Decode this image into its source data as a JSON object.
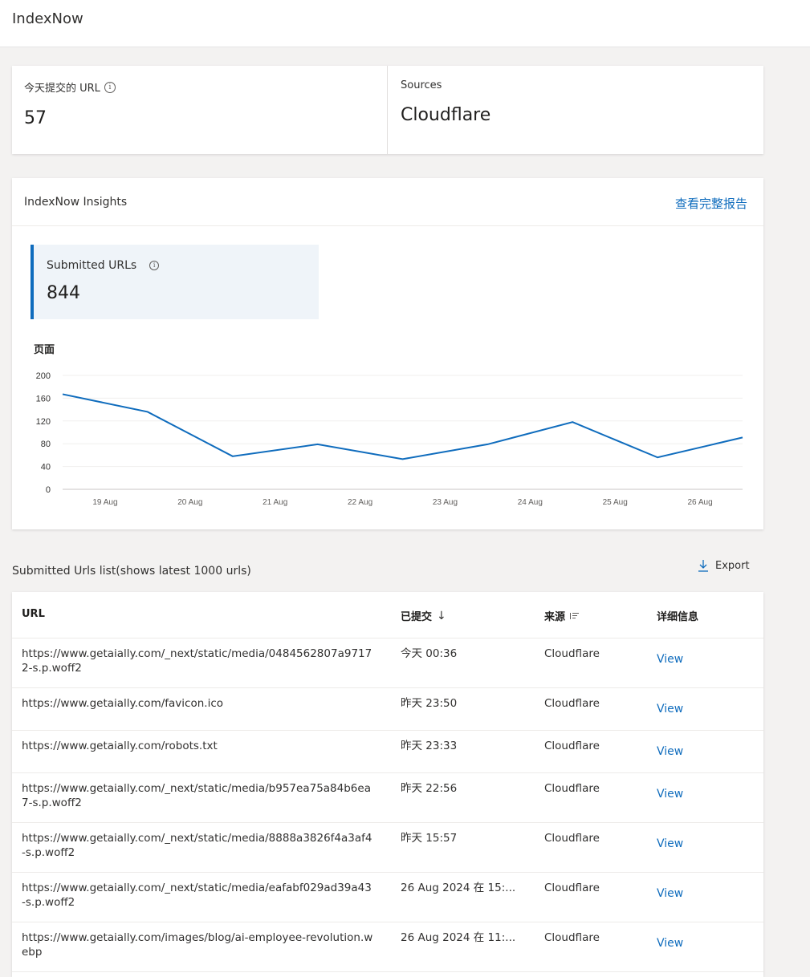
{
  "app": {
    "title": "IndexNow"
  },
  "stats": {
    "today": {
      "label": "今天提交的 URL",
      "value": "57"
    },
    "sources": {
      "label": "Sources",
      "value": "Cloudflare"
    }
  },
  "insights": {
    "title": "IndexNow Insights",
    "full_report_link": "查看完整报告",
    "metric": {
      "label": "Submitted URLs",
      "value": "844"
    }
  },
  "chart_data": {
    "type": "line",
    "ylabel": "页面",
    "ylim": [
      0,
      200
    ],
    "yticks": [
      "0",
      "40",
      "80",
      "120",
      "160",
      "200"
    ],
    "xticks": [
      "19 Aug",
      "20 Aug",
      "21 Aug",
      "22 Aug",
      "23 Aug",
      "24 Aug",
      "25 Aug",
      "26 Aug"
    ],
    "x": [
      0,
      1,
      2,
      3,
      4,
      5,
      6,
      7,
      8
    ],
    "values": [
      167,
      136,
      58,
      79,
      53,
      79,
      118,
      56,
      91
    ],
    "color": "#0f6cbd",
    "grid": true
  },
  "list": {
    "title": "Submitted Urls list(shows latest 1000 urls)",
    "export_label": "Export",
    "columns": {
      "url": "URL",
      "submitted": "已提交",
      "source": "来源",
      "details": "详细信息"
    },
    "rows": [
      {
        "url": "https://www.getaially.com/_next/static/media/0484562807a97172-s.p.woff2",
        "submitted": "今天 00:36",
        "source": "Cloudflare",
        "action": "View"
      },
      {
        "url": "https://www.getaially.com/favicon.ico",
        "submitted": "昨天 23:50",
        "source": "Cloudflare",
        "action": "View"
      },
      {
        "url": "https://www.getaially.com/robots.txt",
        "submitted": "昨天 23:33",
        "source": "Cloudflare",
        "action": "View"
      },
      {
        "url": "https://www.getaially.com/_next/static/media/b957ea75a84b6ea7-s.p.woff2",
        "submitted": "昨天 22:56",
        "source": "Cloudflare",
        "action": "View"
      },
      {
        "url": "https://www.getaially.com/_next/static/media/8888a3826f4a3af4-s.p.woff2",
        "submitted": "昨天 15:57",
        "source": "Cloudflare",
        "action": "View"
      },
      {
        "url": "https://www.getaially.com/_next/static/media/eafabf029ad39a43-s.p.woff2",
        "submitted": "26 Aug 2024 在 15:...",
        "source": "Cloudflare",
        "action": "View"
      },
      {
        "url": "https://www.getaially.com/images/blog/ai-employee-revolution.webp",
        "submitted": "26 Aug 2024 在 11:...",
        "source": "Cloudflare",
        "action": "View"
      }
    ]
  }
}
